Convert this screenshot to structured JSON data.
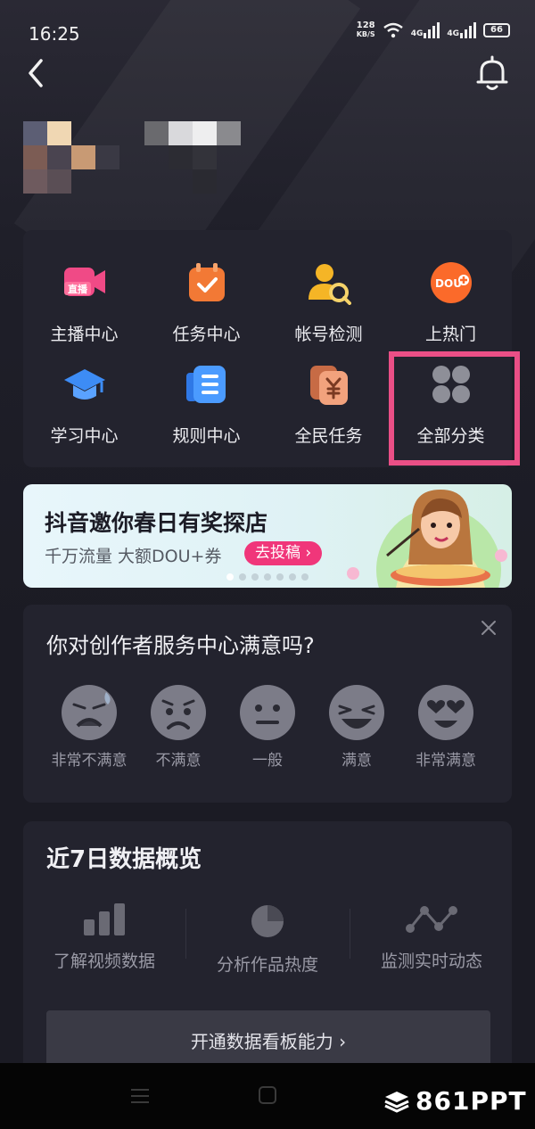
{
  "status_bar": {
    "time": "16:25",
    "net_speed_value": "128",
    "net_speed_unit": "KB/S",
    "signal1_label": "4G",
    "signal2_label": "4G",
    "battery": "66"
  },
  "header": {
    "back_icon": "chevron-left-icon",
    "bell_icon": "bell-icon"
  },
  "tools": [
    {
      "label": "主播中心",
      "icon": "live-camera-icon"
    },
    {
      "label": "任务中心",
      "icon": "calendar-check-icon"
    },
    {
      "label": "帐号检测",
      "icon": "user-search-icon"
    },
    {
      "label": "上热门",
      "icon": "dou-plus-icon"
    },
    {
      "label": "学习中心",
      "icon": "graduation-cap-icon"
    },
    {
      "label": "规则中心",
      "icon": "rules-document-icon"
    },
    {
      "label": "全民任务",
      "icon": "yuan-card-icon"
    },
    {
      "label": "全部分类",
      "icon": "four-dots-icon"
    }
  ],
  "banner": {
    "title": "抖音邀你春日有奖探店",
    "subtitle": "千万流量 大额DOU+券",
    "button": "去投稿 ›",
    "badge_text": "直播",
    "dou_text": "DOU"
  },
  "survey": {
    "title": "你对创作者服务中心满意吗?",
    "options": [
      "非常不满意",
      "不满意",
      "一般",
      "满意",
      "非常满意"
    ]
  },
  "data_overview": {
    "title": "近7日数据概览",
    "items": [
      {
        "label": "了解视频数据",
        "icon": "bar-chart-icon"
      },
      {
        "label": "分析作品热度",
        "icon": "pie-chart-icon"
      },
      {
        "label": "监测实时动态",
        "icon": "line-trend-icon"
      }
    ],
    "button": "开通数据看板能力 ›"
  },
  "watermark": "861PPT",
  "colors": {
    "accent_pink": "#f0367a",
    "highlight_border": "#ea4f86",
    "card_bg": "#23232e"
  }
}
